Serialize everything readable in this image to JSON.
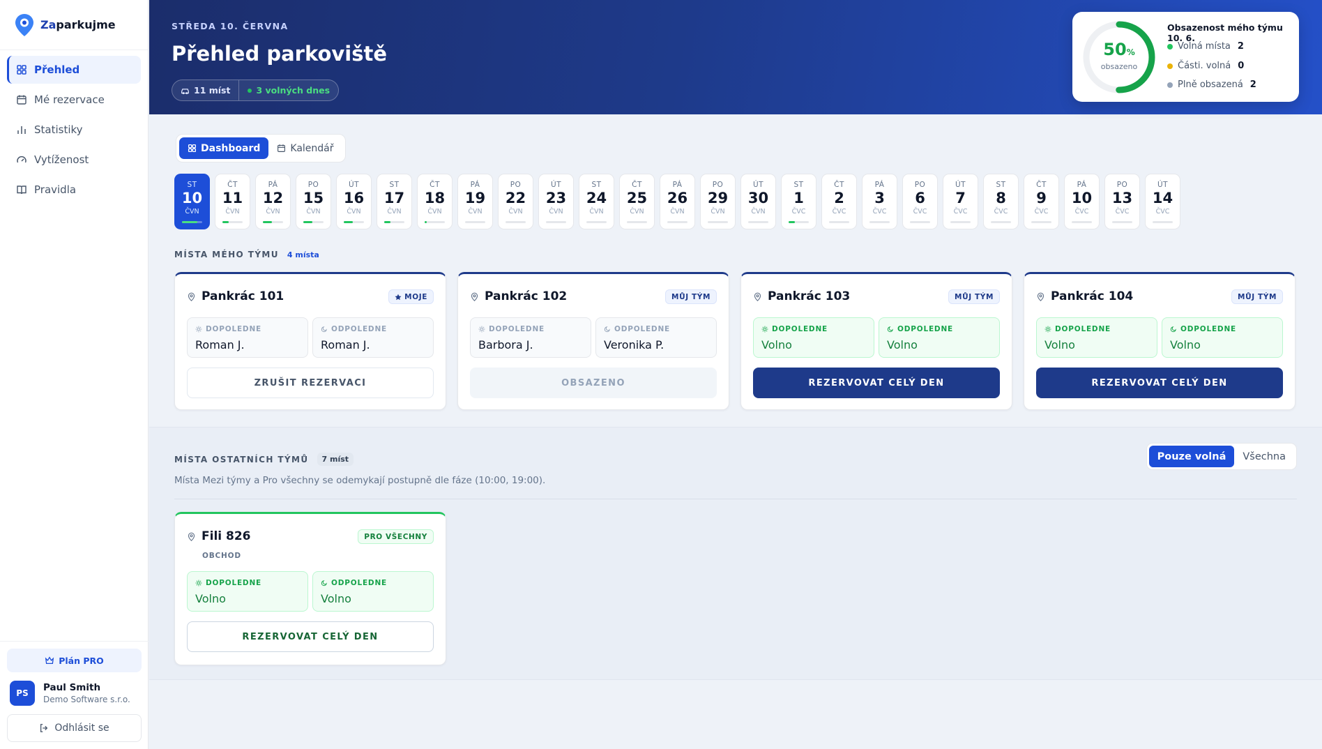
{
  "app": {
    "logo_prefix": "Za",
    "logo_rest": "parkujme"
  },
  "sidebar": {
    "items": [
      {
        "label": "Přehled",
        "icon": "grid-icon"
      },
      {
        "label": "Mé rezervace",
        "icon": "calendar-icon"
      },
      {
        "label": "Statistiky",
        "icon": "bar-chart-icon"
      },
      {
        "label": "Vytíženost",
        "icon": "gauge-icon"
      },
      {
        "label": "Pravidla",
        "icon": "book-icon"
      }
    ],
    "plan": "Plán PRO",
    "user": {
      "initials": "PS",
      "name": "Paul Smith",
      "company": "Demo Software s.r.o."
    },
    "logout": "Odhlásit se"
  },
  "header": {
    "date": "STŘEDA 10. ČERVNA",
    "title": "Přehled parkoviště",
    "chip_spots": "11 míst",
    "chip_free": "3 volných dnes"
  },
  "occupancy": {
    "percent": "50",
    "percent_unit": "%",
    "percent_value": 0.5,
    "caption": "obsazeno",
    "title": "Obsazenost mého týmu 10. 6.",
    "rows": [
      {
        "label": "Volná místa",
        "value": "2",
        "color": "#22c55e"
      },
      {
        "label": "Části. volná",
        "value": "0",
        "color": "#eab308"
      },
      {
        "label": "Plně obsazená",
        "value": "2",
        "color": "#94a3b8"
      }
    ]
  },
  "tabs": {
    "dashboard": "Dashboard",
    "calendar": "Kalendář"
  },
  "days": [
    {
      "w": "ST",
      "n": "10",
      "m": "ČVN",
      "fill": 0.75
    },
    {
      "w": "ČT",
      "n": "11",
      "m": "ČVN",
      "fill": 0.3
    },
    {
      "w": "PÁ",
      "n": "12",
      "m": "ČVN",
      "fill": 0.45
    },
    {
      "w": "PO",
      "n": "15",
      "m": "ČVN",
      "fill": 0.45
    },
    {
      "w": "ÚT",
      "n": "16",
      "m": "ČVN",
      "fill": 0.45
    },
    {
      "w": "ST",
      "n": "17",
      "m": "ČVN",
      "fill": 0.3
    },
    {
      "w": "ČT",
      "n": "18",
      "m": "ČVN",
      "fill": 0.1
    },
    {
      "w": "PÁ",
      "n": "19",
      "m": "ČVN",
      "fill": 0
    },
    {
      "w": "PO",
      "n": "22",
      "m": "ČVN",
      "fill": 0
    },
    {
      "w": "ÚT",
      "n": "23",
      "m": "ČVN",
      "fill": 0
    },
    {
      "w": "ST",
      "n": "24",
      "m": "ČVN",
      "fill": 0
    },
    {
      "w": "ČT",
      "n": "25",
      "m": "ČVN",
      "fill": 0
    },
    {
      "w": "PÁ",
      "n": "26",
      "m": "ČVN",
      "fill": 0
    },
    {
      "w": "PO",
      "n": "29",
      "m": "ČVN",
      "fill": 0
    },
    {
      "w": "ÚT",
      "n": "30",
      "m": "ČVN",
      "fill": 0
    },
    {
      "w": "ST",
      "n": "1",
      "m": "ČVC",
      "fill": 0.3
    },
    {
      "w": "ČT",
      "n": "2",
      "m": "ČVC",
      "fill": 0
    },
    {
      "w": "PÁ",
      "n": "3",
      "m": "ČVC",
      "fill": 0
    },
    {
      "w": "PO",
      "n": "6",
      "m": "ČVC",
      "fill": 0
    },
    {
      "w": "ÚT",
      "n": "7",
      "m": "ČVC",
      "fill": 0
    },
    {
      "w": "ST",
      "n": "8",
      "m": "ČVC",
      "fill": 0
    },
    {
      "w": "ČT",
      "n": "9",
      "m": "ČVC",
      "fill": 0
    },
    {
      "w": "PÁ",
      "n": "10",
      "m": "ČVC",
      "fill": 0
    },
    {
      "w": "PO",
      "n": "13",
      "m": "ČVC",
      "fill": 0
    },
    {
      "w": "ÚT",
      "n": "14",
      "m": "ČVC",
      "fill": 0
    }
  ],
  "my_team": {
    "title": "MÍSTA MÉHO TÝMU",
    "count": "4 místa",
    "spots": [
      {
        "name": "Pankrác 101",
        "badge": "MOJE",
        "am_label": "DOPOLEDNE",
        "am": "Roman J.",
        "pm_label": "ODPOLEDNE",
        "pm": "Roman J.",
        "action": "ZRUŠIT REZERVACI"
      },
      {
        "name": "Pankrác 102",
        "badge": "MŮJ TÝM",
        "am_label": "DOPOLEDNE",
        "am": "Barbora J.",
        "pm_label": "ODPOLEDNE",
        "pm": "Veronika P.",
        "action": "OBSAZENO"
      },
      {
        "name": "Pankrác 103",
        "badge": "MŮJ TÝM",
        "am_label": "DOPOLEDNE",
        "am": "Volno",
        "pm_label": "ODPOLEDNE",
        "pm": "Volno",
        "action": "REZERVOVAT CELÝ DEN"
      },
      {
        "name": "Pankrác 104",
        "badge": "MŮJ TÝM",
        "am_label": "DOPOLEDNE",
        "am": "Volno",
        "pm_label": "ODPOLEDNE",
        "pm": "Volno",
        "action": "REZERVOVAT CELÝ DEN"
      }
    ]
  },
  "other_teams": {
    "title": "MÍSTA OSTATNÍCH TÝMŮ",
    "count": "7 míst",
    "filter_free": "Pouze volná",
    "filter_all": "Všechna",
    "note": "Místa Mezi týmy a Pro všechny se odemykají postupně dle fáze (10:00, 19:00).",
    "spots": [
      {
        "name": "Fili 826",
        "badge": "PRO VŠECHNY",
        "sub": "OBCHOD",
        "am_label": "DOPOLEDNE",
        "am": "Volno",
        "pm_label": "ODPOLEDNE",
        "pm": "Volno",
        "action": "REZERVOVAT CELÝ DEN"
      }
    ]
  }
}
